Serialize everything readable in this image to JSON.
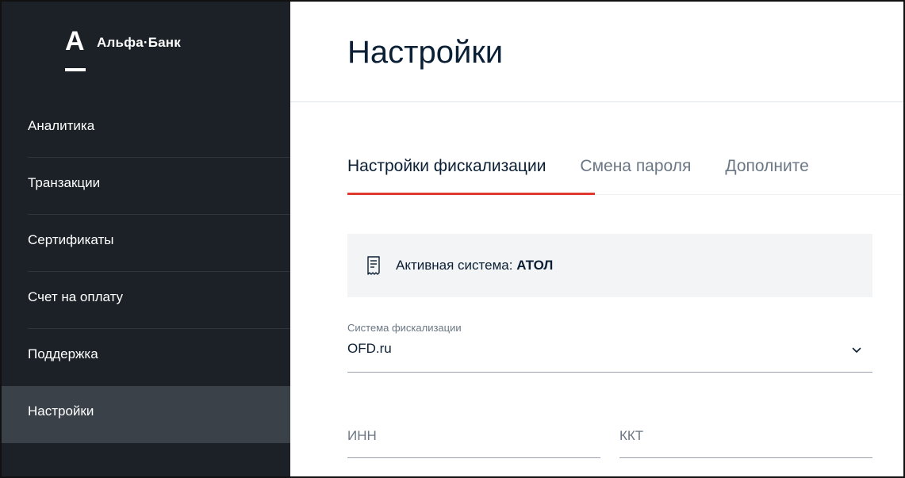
{
  "brand": {
    "letter": "A",
    "name": "Альфа·Банк"
  },
  "sidebar": {
    "items": [
      {
        "label": "Аналитика",
        "active": false
      },
      {
        "label": "Транзакции",
        "active": false
      },
      {
        "label": "Сертификаты",
        "active": false
      },
      {
        "label": "Счет на оплату",
        "active": false
      },
      {
        "label": "Поддержка",
        "active": false
      },
      {
        "label": "Настройки",
        "active": true
      }
    ]
  },
  "main": {
    "title": "Настройки",
    "tabs": [
      {
        "label": "Настройки фискализации",
        "active": true
      },
      {
        "label": "Смена пароля",
        "active": false
      },
      {
        "label": "Дополните",
        "active": false
      }
    ],
    "info": {
      "icon": "receipt-icon",
      "prefix": "Активная система:",
      "value": "АТОЛ"
    },
    "fiscal_select": {
      "label": "Система фискализации",
      "value": "OFD.ru",
      "icon": "chevron-down-icon"
    },
    "inn_field": {
      "placeholder": "ИНН",
      "value": ""
    },
    "kkt_field": {
      "placeholder": "ККТ",
      "value": ""
    }
  },
  "colors": {
    "sidebar_bg": "#1b2127",
    "sidebar_active_bg": "#3a4149",
    "accent_red": "#e03a2f",
    "info_bg": "#f3f4f5",
    "text_dark": "#0b1f35",
    "text_muted": "#6b7784"
  }
}
